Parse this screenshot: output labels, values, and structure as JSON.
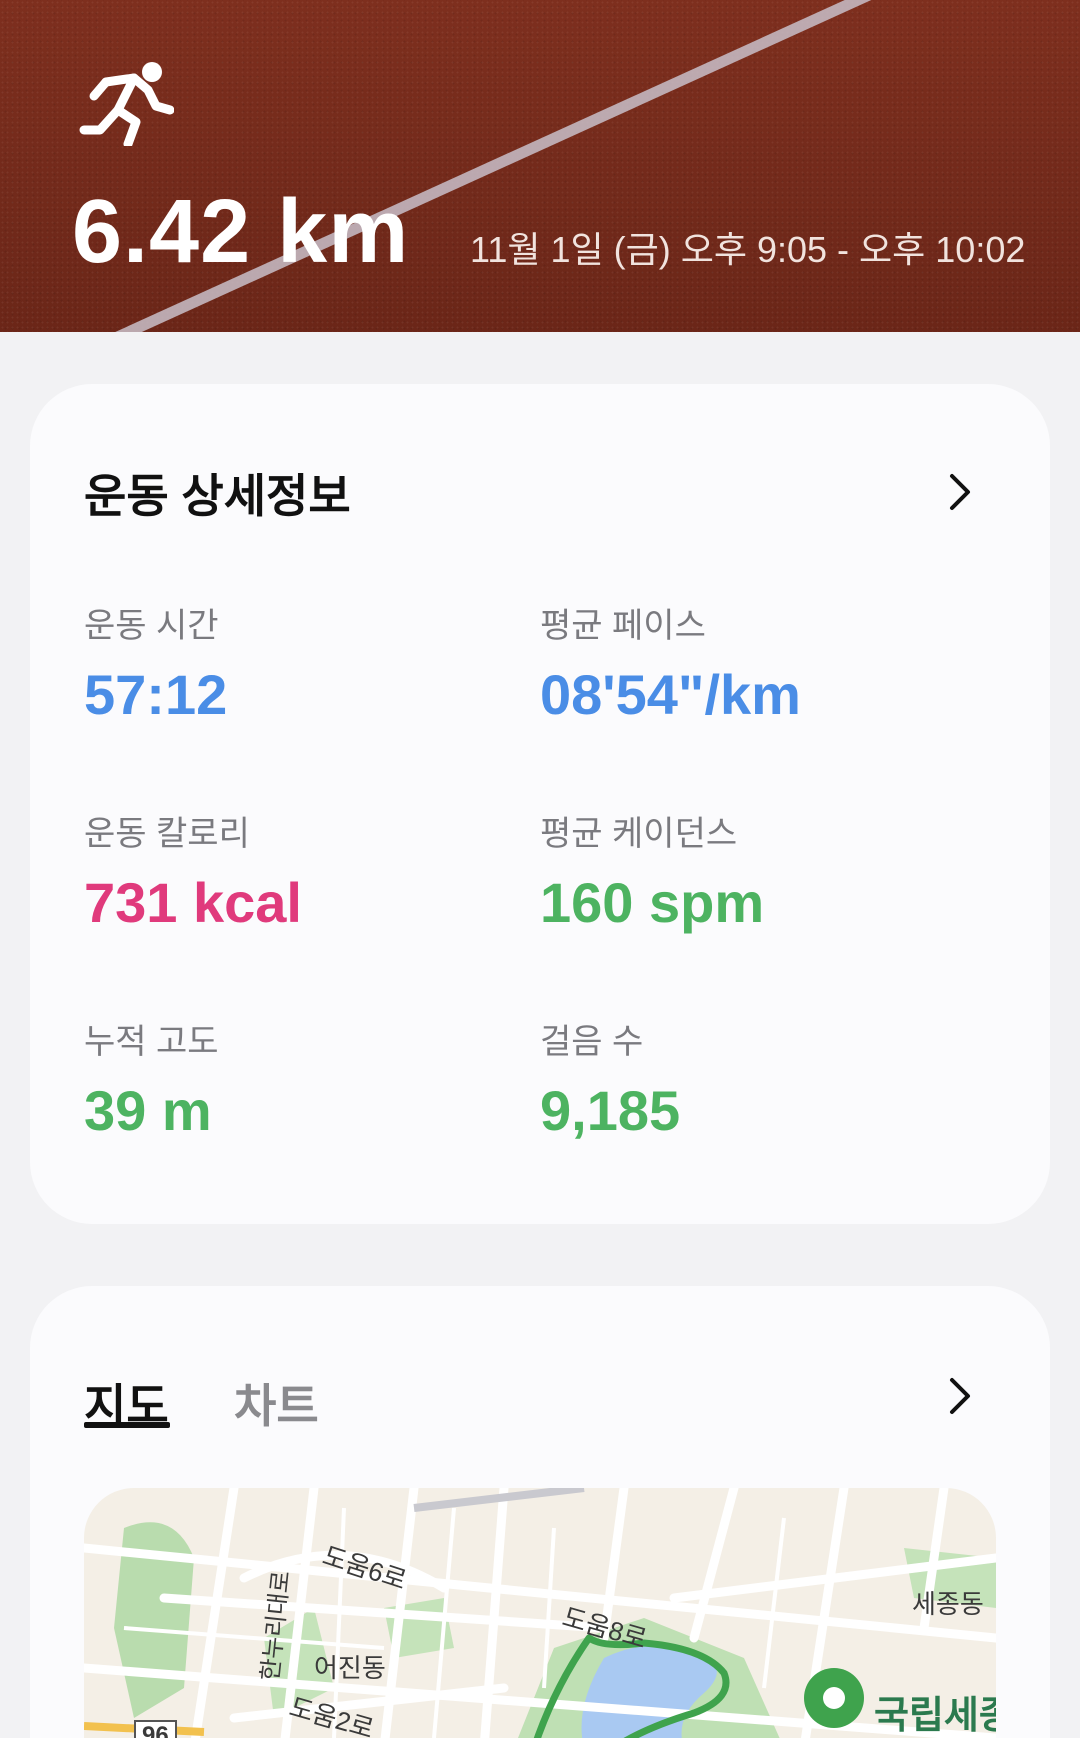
{
  "header": {
    "distance": "6.42 km",
    "datetime": "11월 1일 (금) 오후 9:05 - 오후 10:02",
    "icon": "running-person-icon",
    "background": "#7a2d1d"
  },
  "detail": {
    "title": "운동 상세정보",
    "stats": [
      {
        "label": "운동 시간",
        "value": "57:12",
        "color": "#4a8de6"
      },
      {
        "label": "평균 페이스",
        "value": "08'54\"/km",
        "color": "#4a8de6"
      },
      {
        "label": "운동 칼로리",
        "value": "731 kcal",
        "color": "#e03a7c"
      },
      {
        "label": "평균 케이던스",
        "value": "160 spm",
        "color": "#4db361"
      },
      {
        "label": "누적 고도",
        "value": "39 m",
        "color": "#4db361"
      },
      {
        "label": "걸음 수",
        "value": "9,185",
        "color": "#4db361"
      }
    ]
  },
  "map_section": {
    "tabs": [
      {
        "label": "지도"
      },
      {
        "label": "차트"
      }
    ],
    "active_tab": "지도",
    "map_labels": {
      "road1": "도움6로",
      "road2": "도움8로",
      "road3": "도움2로",
      "road4": "한누리대로",
      "district1": "어진동",
      "district2": "세종동",
      "place": "국립세종",
      "route_number": "96"
    },
    "route_color": "#3fa34d"
  }
}
